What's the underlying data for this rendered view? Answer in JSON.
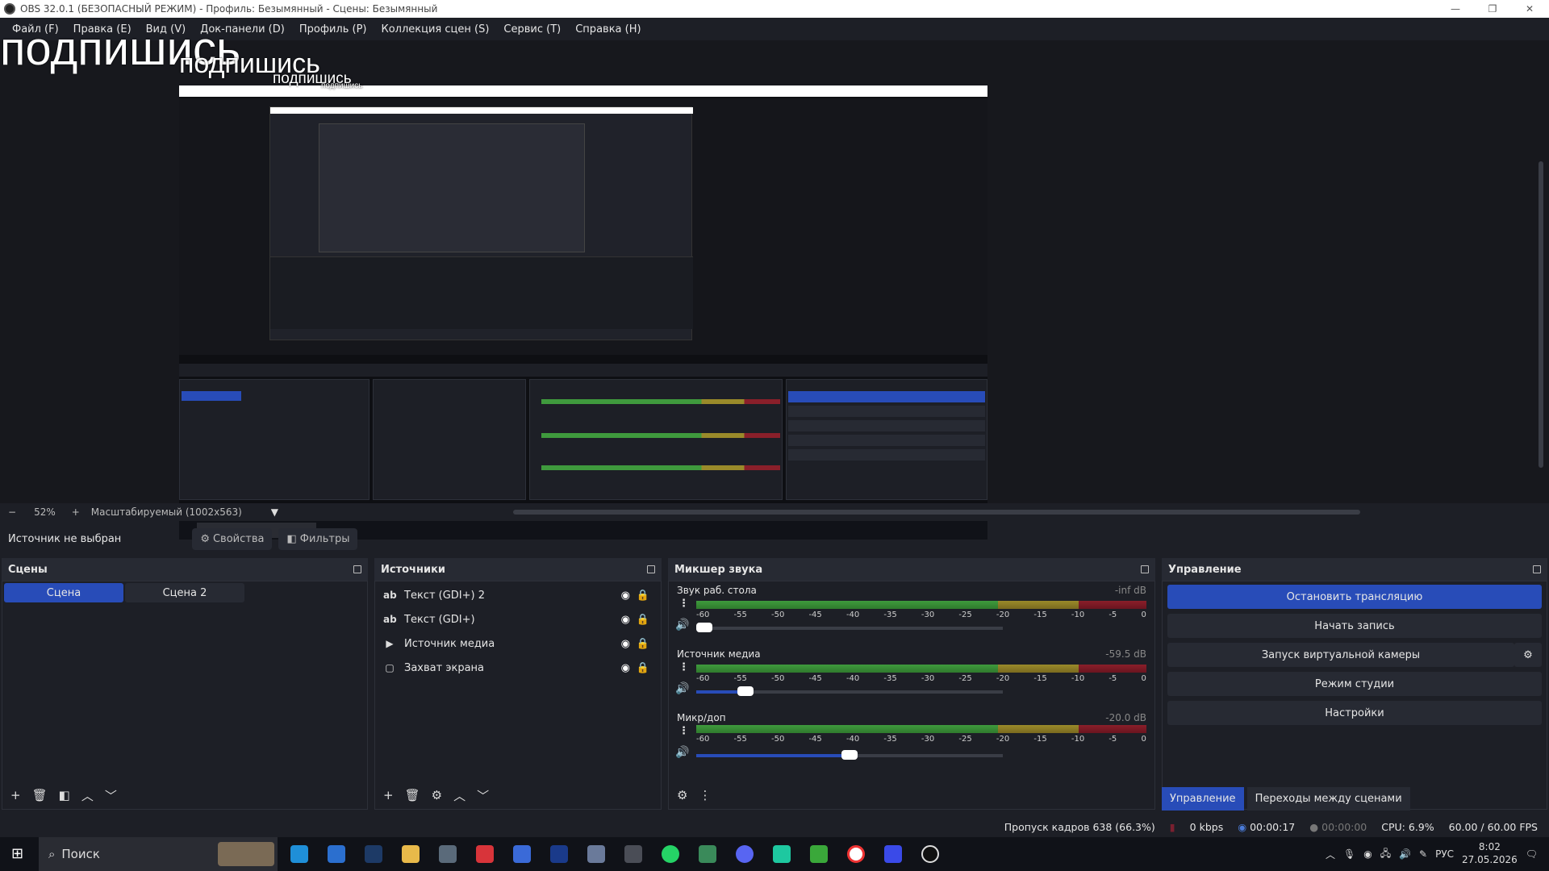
{
  "window": {
    "title": "OBS 32.0.1 (БЕЗОПАСНЫЙ РЕЖИМ) - Профиль: Безымянный - Сцены: Безымянный",
    "minimize": "—",
    "restore": "❐",
    "close": "✕"
  },
  "menu": [
    "Файл (F)",
    "Правка (E)",
    "Вид (V)",
    "Док-панели (D)",
    "Профиль (P)",
    "Коллекция сцен (S)",
    "Сервис (T)",
    "Справка (H)"
  ],
  "overlay": {
    "text": "подпишись"
  },
  "zoom": {
    "minus": "−",
    "percent": "52%",
    "plus": "+",
    "mode": "Масштабируемый (1002x563)",
    "arrow": "▼"
  },
  "source_bar": {
    "selected": "Источник не выбран",
    "properties": "Свойства",
    "filters": "Фильтры"
  },
  "scenes": {
    "title": "Сцены",
    "items": [
      "Сцена",
      "Сцена 2"
    ]
  },
  "sources": {
    "title": "Источники",
    "items": [
      {
        "icon": "ab",
        "name": "Текст (GDI+) 2"
      },
      {
        "icon": "ab",
        "name": "Текст (GDI+)"
      },
      {
        "icon": "▶",
        "name": "Источник медиа"
      },
      {
        "icon": "▢",
        "name": "Захват экрана"
      }
    ]
  },
  "mixer": {
    "title": "Микшер звука",
    "ticks": [
      "-60",
      "-55",
      "-50",
      "-45",
      "-40",
      "-35",
      "-30",
      "-25",
      "-20",
      "-15",
      "-10",
      "-5",
      "0"
    ],
    "channels": [
      {
        "name": "Звук раб. стола",
        "db": "-inf dB",
        "volume": 0.0
      },
      {
        "name": "Источник медиа",
        "db": "-59.5 dB",
        "volume": 0.16
      },
      {
        "name": "Микр/доп",
        "db": "-20.0 dB",
        "volume": 0.5
      }
    ]
  },
  "controls": {
    "title": "Управление",
    "buttons": [
      "Остановить трансляцию",
      "Начать запись",
      "Запуск виртуальной камеры",
      "Режим студии",
      "Настройки"
    ],
    "tabs": [
      "Управление",
      "Переходы между сценами"
    ]
  },
  "status": {
    "dropped": "Пропуск кадров 638 (66.3%)",
    "kbps": "0 kbps",
    "stream_time": "00:00:17",
    "rec_time": "00:00:00",
    "cpu": "CPU: 6.9%",
    "fps": "60.00 / 60.00 FPS"
  },
  "taskbar": {
    "search": "Поиск",
    "lang": "РУС",
    "time": "8:02",
    "date": "27.05.2026"
  },
  "colors": {
    "accent": "#284cb8",
    "bg": "#1d1f26",
    "panel": "#272a33"
  }
}
